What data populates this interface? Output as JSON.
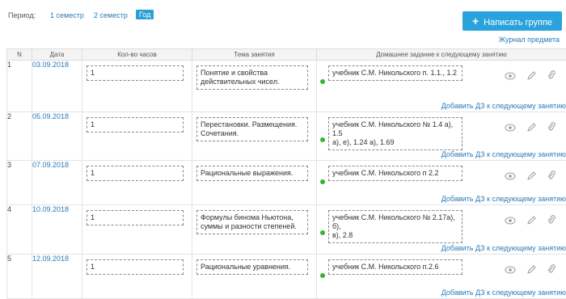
{
  "period": {
    "label": "Период:",
    "options": [
      "1 семестр",
      "2 семестр",
      "Год"
    ],
    "active": "Год"
  },
  "write_button": {
    "label": "Написать группе",
    "icon": "plus-icon"
  },
  "journal_link": "Журнал предмета",
  "table": {
    "headers": [
      "N",
      "Дата",
      "Кол-во часов",
      "Тема занятия",
      "Домашнее задание к следующему занятию"
    ],
    "add_link_label": "Добавить ДЗ к следующему занятию",
    "rows": [
      {
        "n": "1",
        "date": "03.09.2018",
        "hours": "1",
        "topic": [
          "Понятие и свойства",
          "действительных чисел."
        ],
        "homework": [
          "учебник С.М. Никольского п. 1.1., 1.2"
        ]
      },
      {
        "n": "2",
        "date": "05.09.2018",
        "hours": "1",
        "topic": [
          "Перестановки. Размещения.",
          "Сочетания."
        ],
        "homework": [
          "учебник С.М. Никольского № 1.4 а), 1.5",
          "а), е), 1.24 а), 1.69"
        ]
      },
      {
        "n": "3",
        "date": "07.09.2018",
        "hours": "1",
        "topic": [
          "Рациональные выражения."
        ],
        "homework": [
          "учебник С.М. Никольского п 2.2"
        ]
      },
      {
        "n": "4",
        "date": "10.09.2018",
        "hours": "1",
        "topic": [
          "Формулы бинома Ньютона,",
          "суммы и разности степеней."
        ],
        "homework": [
          "учебник С.М. Никольского № 2.17а), б),",
          "в), 2.8"
        ]
      },
      {
        "n": "5",
        "date": "12.09.2018",
        "hours": "1",
        "topic": [
          "Рациональные уравнения."
        ],
        "homework": [
          "учебник С.М. Никольского п.2.6"
        ]
      }
    ]
  },
  "colors": {
    "accent": "#2aa3dc",
    "link": "#2a7ab8",
    "status_dot": "#36b336"
  },
  "icons": {
    "row_actions": [
      "eye-icon",
      "pencil-icon",
      "paperclip-icon"
    ]
  }
}
